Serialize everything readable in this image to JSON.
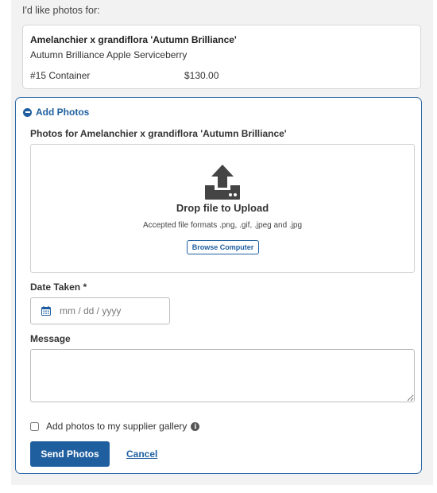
{
  "intro": "I'd like photos for:",
  "plant": {
    "botanical_name": "Amelanchier x grandiflora 'Autumn Brilliance'",
    "common_name": "Autumn Brilliance Apple Serviceberry",
    "size": "#15 Container",
    "price": "$130.00"
  },
  "photos_panel": {
    "toggle_label": "Add Photos",
    "photos_for_label": "Photos for Amelanchier x grandiflora 'Autumn Brilliance'",
    "dropzone": {
      "title": "Drop file to Upload",
      "accepted_formats": "Accepted file formats .png, .gif, .jpeg and .jpg",
      "browse_label": "Browse Computer",
      "icon": "upload-icon"
    },
    "date": {
      "label": "Date Taken *",
      "placeholder": "mm / dd / yyyy",
      "value": "",
      "icon": "calendar-icon"
    },
    "message": {
      "label": "Message",
      "value": ""
    },
    "gallery": {
      "label": "Add photos to my supplier gallery",
      "checked": false,
      "icon": "info-icon"
    },
    "send_label": "Send Photos",
    "cancel_label": "Cancel"
  },
  "colors": {
    "accent": "#1f5fa0",
    "panel_background": "#f2f2f2"
  }
}
